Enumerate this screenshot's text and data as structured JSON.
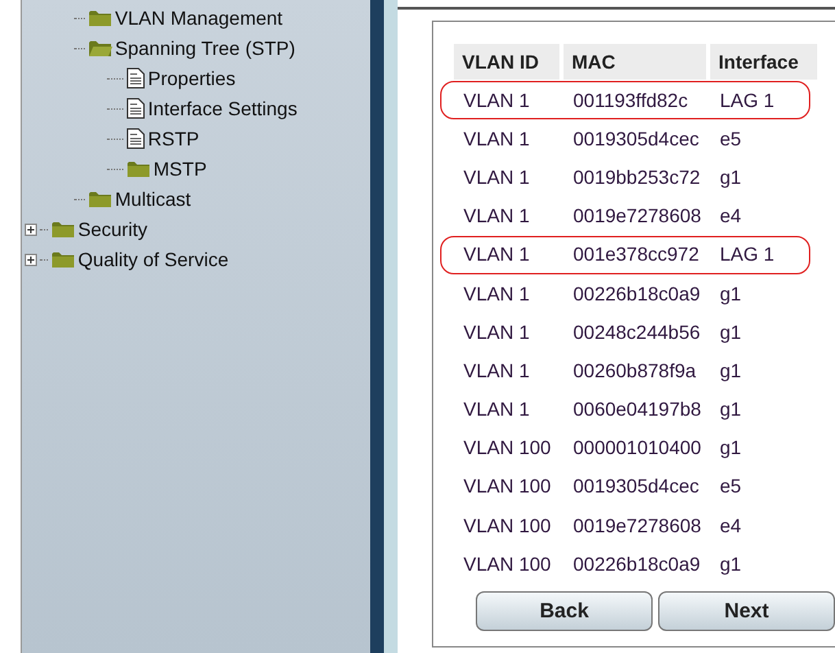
{
  "tree": {
    "branch_items": [
      {
        "label": "VLAN Management",
        "kind": "folder",
        "expanded": false
      },
      {
        "label": "Spanning Tree (STP)",
        "kind": "folder",
        "expanded": true,
        "children": [
          {
            "label": "Properties",
            "kind": "page"
          },
          {
            "label": "Interface Settings",
            "kind": "page"
          },
          {
            "label": "RSTP",
            "kind": "page"
          },
          {
            "label": "MSTP",
            "kind": "folder"
          }
        ]
      },
      {
        "label": "Multicast",
        "kind": "folder",
        "expanded": false
      }
    ],
    "root_items": [
      {
        "label": "Security",
        "kind": "folder",
        "expanded": false
      },
      {
        "label": "Quality of Service",
        "kind": "folder",
        "expanded": false
      }
    ]
  },
  "table": {
    "columns": [
      "VLAN ID",
      "MAC",
      "Interface"
    ],
    "rows": [
      {
        "cells": [
          "VLAN 1",
          "001193ffd82c",
          "LAG 1"
        ],
        "highlighted": true
      },
      {
        "cells": [
          "VLAN 1",
          "0019305d4cec",
          "e5"
        ],
        "highlighted": false
      },
      {
        "cells": [
          "VLAN 1",
          "0019bb253c72",
          "g1"
        ],
        "highlighted": false
      },
      {
        "cells": [
          "VLAN 1",
          "0019e7278608",
          "e4"
        ],
        "highlighted": false
      },
      {
        "cells": [
          "VLAN 1",
          "001e378cc972",
          "LAG 1"
        ],
        "highlighted": true
      },
      {
        "cells": [
          "VLAN 1",
          "00226b18c0a9",
          "g1"
        ],
        "highlighted": false
      },
      {
        "cells": [
          "VLAN 1",
          "00248c244b56",
          "g1"
        ],
        "highlighted": false
      },
      {
        "cells": [
          "VLAN 1",
          "00260b878f9a",
          "g1"
        ],
        "highlighted": false
      },
      {
        "cells": [
          "VLAN 1",
          "0060e04197b8",
          "g1"
        ],
        "highlighted": false
      },
      {
        "cells": [
          "VLAN 100",
          "000001010400",
          "g1"
        ],
        "highlighted": false
      },
      {
        "cells": [
          "VLAN 100",
          "0019305d4cec",
          "e5"
        ],
        "highlighted": false
      },
      {
        "cells": [
          "VLAN 100",
          "0019e7278608",
          "e4"
        ],
        "highlighted": false
      },
      {
        "cells": [
          "VLAN 100",
          "00226b18c0a9",
          "g1"
        ],
        "highlighted": false
      }
    ]
  },
  "buttons": [
    "Back",
    "Next"
  ]
}
